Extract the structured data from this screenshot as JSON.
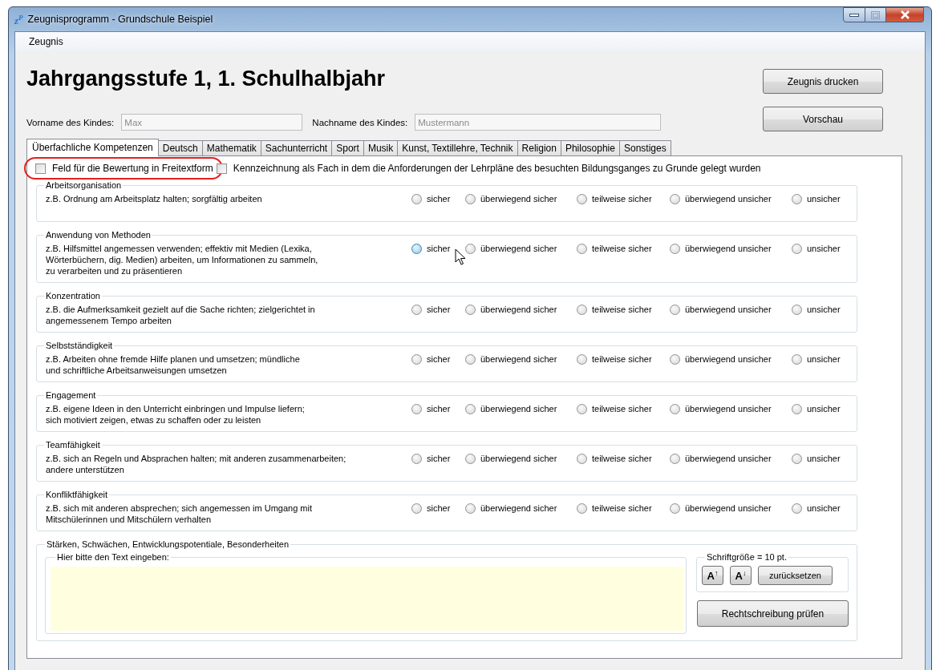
{
  "window": {
    "icon_text": "z$^{P}$",
    "title": "Zeugnisprogramm - Grundschule Beispiel"
  },
  "menu": [
    {
      "label": "Zeugnis"
    }
  ],
  "heading": "Jahrgangsstufe 1, 1. Schulhalbjahr",
  "actions": [
    "Zeugnis drucken",
    "Vorschau"
  ],
  "fields": [
    {
      "label": "Vorname des Kindes:",
      "value": "Max",
      "disabled": true
    },
    {
      "label": "Nachname des Kindes:",
      "value": "Mustermann",
      "disabled": true
    }
  ],
  "tabs": [
    {
      "label": "Überfachliche Kompetenzen",
      "selected": true
    },
    {
      "label": "Deutsch",
      "selected": false
    },
    {
      "label": "Mathematik",
      "selected": false
    },
    {
      "label": "Sachunterricht",
      "selected": false
    },
    {
      "label": "Sport",
      "selected": false
    },
    {
      "label": "Musik",
      "selected": false
    },
    {
      "label": "Kunst, Textillehre, Technik",
      "selected": false
    },
    {
      "label": "Religion",
      "selected": false
    },
    {
      "label": "Philosophie",
      "selected": false
    },
    {
      "label": "Sonstiges",
      "selected": false
    }
  ],
  "options": [
    {
      "label": "Feld für die Bewertung in Freitextform",
      "checked": false,
      "highlighted": true
    },
    {
      "label": "Kennzeichnung als Fach in dem die Anforderungen der Lehrpläne des besuchten Bildungsganges zu Grunde gelegt wurden",
      "checked": false,
      "highlighted": false
    }
  ],
  "groups": [
    {
      "title": "Arbeitsorganisation",
      "description": "z.B. Ordnung am Arbeitsplatz halten; sorgfältig arbeiten",
      "ratings": [
        {
          "label": "sicher",
          "selected": false,
          "hovered": false
        },
        {
          "label": "überwiegend sicher",
          "selected": false,
          "hovered": false
        },
        {
          "label": "teilweise sicher",
          "selected": false,
          "hovered": false
        },
        {
          "label": "überwiegend unsicher",
          "selected": false,
          "hovered": false
        },
        {
          "label": "unsicher",
          "selected": false,
          "hovered": false
        }
      ]
    },
    {
      "title": "Anwendung von Methoden",
      "description": "z.B. Hilfsmittel angemessen verwenden; effektiv mit Medien (Lexika,\nWörterbüchern, dig. Medien) arbeiten, um Informationen zu sammeln,\nzu verarbeiten und zu präsentieren",
      "ratings": [
        {
          "label": "sicher",
          "selected": false,
          "hovered": true
        },
        {
          "label": "überwiegend sicher",
          "selected": false,
          "hovered": false
        },
        {
          "label": "teilweise sicher",
          "selected": false,
          "hovered": false
        },
        {
          "label": "überwiegend unsicher",
          "selected": false,
          "hovered": false
        },
        {
          "label": "unsicher",
          "selected": false,
          "hovered": false
        }
      ]
    },
    {
      "title": "Konzentration",
      "description": "z.B. die Aufmerksamkeit gezielt auf die Sache richten; zielgerichtet in\nangemessenem Tempo arbeiten",
      "ratings": [
        {
          "label": "sicher",
          "selected": false,
          "hovered": false
        },
        {
          "label": "überwiegend sicher",
          "selected": false,
          "hovered": false
        },
        {
          "label": "teilweise sicher",
          "selected": false,
          "hovered": false
        },
        {
          "label": "überwiegend unsicher",
          "selected": false,
          "hovered": false
        },
        {
          "label": "unsicher",
          "selected": false,
          "hovered": false
        }
      ]
    },
    {
      "title": "Selbstständigkeit",
      "description": "z.B. Arbeiten ohne fremde Hilfe planen und umsetzen; mündliche\nund schriftliche Arbeitsanweisungen umsetzen",
      "ratings": [
        {
          "label": "sicher",
          "selected": false,
          "hovered": false
        },
        {
          "label": "überwiegend sicher",
          "selected": false,
          "hovered": false
        },
        {
          "label": "teilweise sicher",
          "selected": false,
          "hovered": false
        },
        {
          "label": "überwiegend unsicher",
          "selected": false,
          "hovered": false
        },
        {
          "label": "unsicher",
          "selected": false,
          "hovered": false
        }
      ]
    },
    {
      "title": "Engagement",
      "description": "z.B. eigene Ideen in den Unterricht einbringen und Impulse liefern;\nsich motiviert zeigen, etwas zu schaffen oder zu leisten",
      "ratings": [
        {
          "label": "sicher",
          "selected": false,
          "hovered": false
        },
        {
          "label": "überwiegend sicher",
          "selected": false,
          "hovered": false
        },
        {
          "label": "teilweise sicher",
          "selected": false,
          "hovered": false
        },
        {
          "label": "überwiegend unsicher",
          "selected": false,
          "hovered": false
        },
        {
          "label": "unsicher",
          "selected": false,
          "hovered": false
        }
      ]
    },
    {
      "title": "Teamfähigkeit",
      "description": "z.B. sich an Regeln und Absprachen halten; mit anderen zusammenarbeiten;\nandere unterstützen",
      "ratings": [
        {
          "label": "sicher",
          "selected": false,
          "hovered": false
        },
        {
          "label": "überwiegend sicher",
          "selected": false,
          "hovered": false
        },
        {
          "label": "teilweise sicher",
          "selected": false,
          "hovered": false
        },
        {
          "label": "überwiegend unsicher",
          "selected": false,
          "hovered": false
        },
        {
          "label": "unsicher",
          "selected": false,
          "hovered": false
        }
      ]
    },
    {
      "title": "Konfliktfähigkeit",
      "description": "z.B. sich mit anderen absprechen; sich angemessen im Umgang mit\nMitschülerinnen und Mitschülern verhalten",
      "ratings": [
        {
          "label": "sicher",
          "selected": false,
          "hovered": false
        },
        {
          "label": "überwiegend sicher",
          "selected": false,
          "hovered": false
        },
        {
          "label": "teilweise sicher",
          "selected": false,
          "hovered": false
        },
        {
          "label": "überwiegend unsicher",
          "selected": false,
          "hovered": false
        },
        {
          "label": "unsicher",
          "selected": false,
          "hovered": false
        }
      ]
    }
  ],
  "notes": {
    "title": "Stärken, Schwächen, Entwicklungspotentiale, Besonderheiten",
    "input_label": "Hier bitte den Text eingeben:",
    "font_size_label": "Schriftgröße = 10 pt.",
    "font_buttons": [
      "A$^{↑}$",
      "A$^{↓}$"
    ],
    "reset": "zurücksetzen",
    "spellcheck": "Rechtschreibung prüfen"
  }
}
